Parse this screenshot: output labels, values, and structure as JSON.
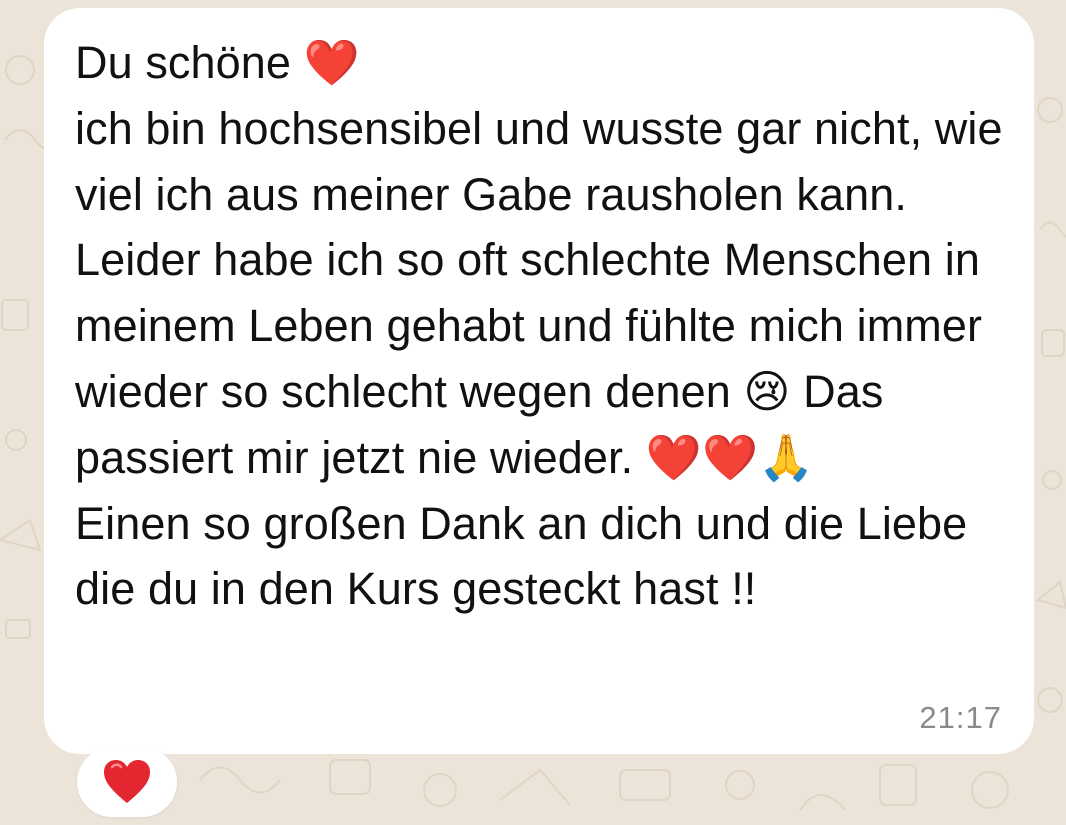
{
  "message": {
    "text": "Du schöne ❤️\nich bin hochsensibel und wusste gar nicht, wie viel ich aus meiner Gabe rausholen kann. Leider habe ich so oft schlechte Menschen in meinem Leben gehabt und fühlte mich immer wieder so schlecht wegen denen 😢 Das passiert mir jetzt nie wieder. ❤️❤️🙏\nEinen so großen Dank an dich und die Liebe die du in den Kurs gesteckt hast !!",
    "time": "21:17"
  },
  "reaction": {
    "emoji": "❤️",
    "icon": "red-heart-icon"
  },
  "colors": {
    "background": "#ece4d8",
    "bubble": "#ffffff",
    "text": "#111111",
    "timestamp": "#8a8a8a",
    "heart": "#e3262f"
  }
}
